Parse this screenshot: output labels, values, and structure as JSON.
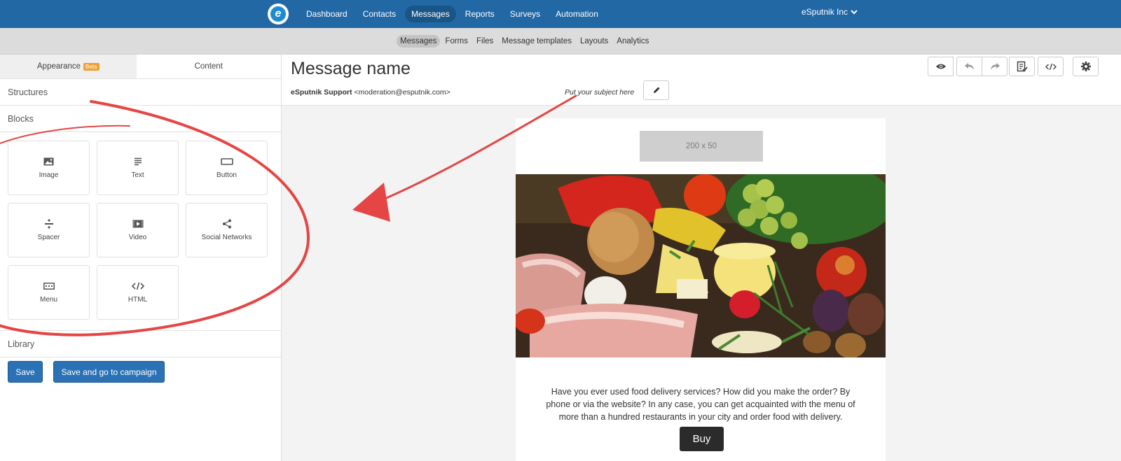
{
  "topnav": {
    "items": [
      "Dashboard",
      "Contacts",
      "Messages",
      "Reports",
      "Surveys",
      "Automation"
    ],
    "active": "Messages",
    "account": "eSputnik Inc"
  },
  "subnav": {
    "items": [
      "Messages",
      "Forms",
      "Files",
      "Message templates",
      "Layouts",
      "Analytics"
    ],
    "active": "Messages"
  },
  "left_panel": {
    "tabs": {
      "appearance": "Appearance",
      "beta_badge": "Beta",
      "content": "Content"
    },
    "sections": {
      "structures": "Structures",
      "blocks": "Blocks",
      "library": "Library"
    },
    "blocks": [
      {
        "label": "Image",
        "icon": "image-icon"
      },
      {
        "label": "Text",
        "icon": "text-icon"
      },
      {
        "label": "Button",
        "icon": "button-icon"
      },
      {
        "label": "Spacer",
        "icon": "spacer-icon"
      },
      {
        "label": "Video",
        "icon": "video-icon"
      },
      {
        "label": "Social Networks",
        "icon": "share-icon"
      },
      {
        "label": "Menu",
        "icon": "menu-icon"
      },
      {
        "label": "HTML",
        "icon": "code-icon"
      }
    ],
    "save_label": "Save",
    "save_campaign_label": "Save and go to campaign"
  },
  "editor": {
    "message_name": "Message name",
    "sender_name": "eSputnik Support",
    "sender_email": "<moderation@esputnik.com>",
    "subject_placeholder": "Put your subject here",
    "toolbar_icons": [
      "eye-icon",
      "undo-icon",
      "redo-icon",
      "checklist-icon",
      "code-icon",
      "gear-icon"
    ]
  },
  "email": {
    "logo_placeholder": "200 x 50",
    "body_text": "Have you ever used food delivery services? How did you make the order? By phone or via the website? In any case, you can get acquainted with the menu of more than a hundred restaurants in your city and order food with delivery.",
    "buy_label": "Buy"
  },
  "colors": {
    "nav_blue": "#2168a5",
    "button_blue": "#2a72b5",
    "annotation_red": "#e54545",
    "beta_orange": "#f0a030"
  }
}
